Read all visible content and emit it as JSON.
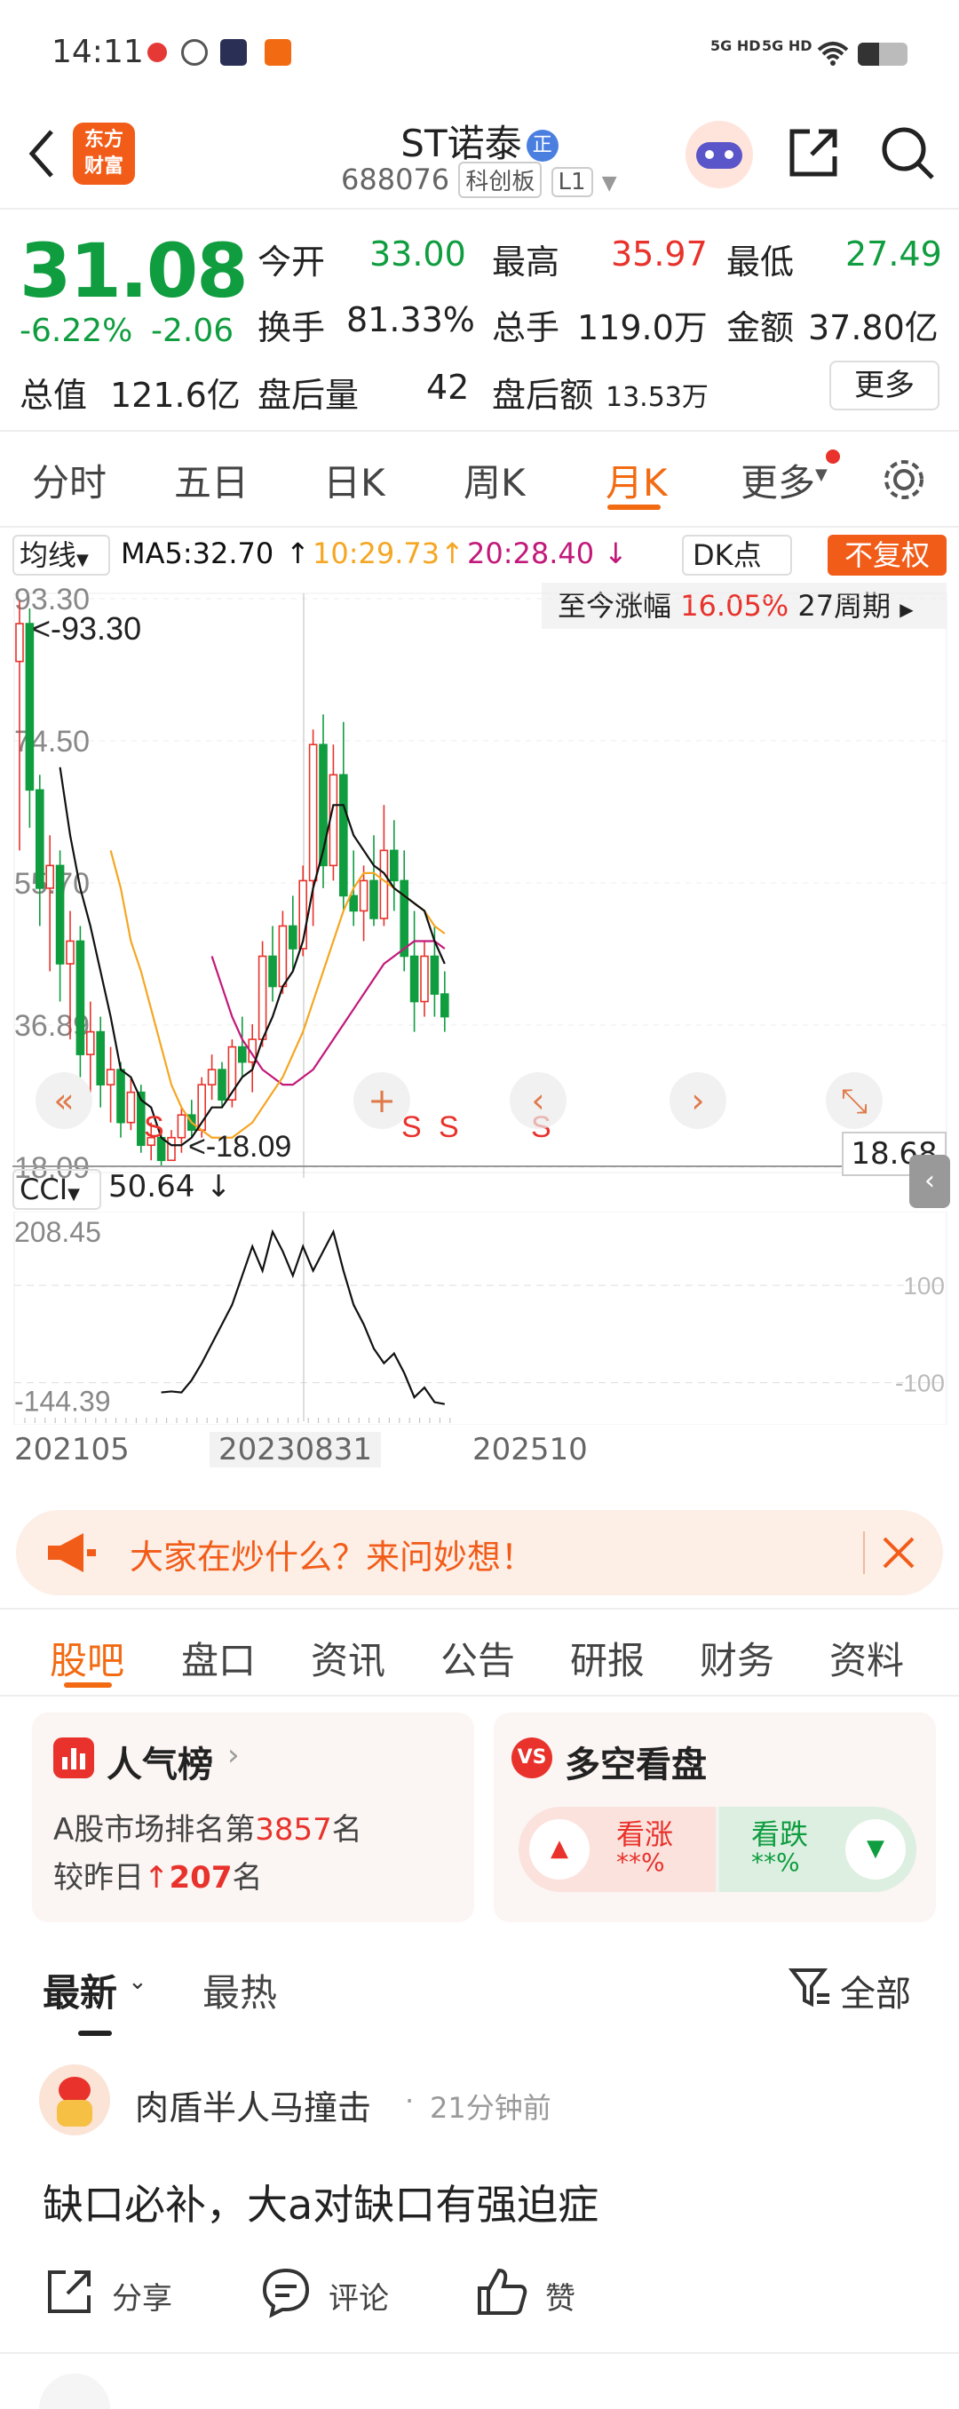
{
  "status_bar": {
    "time": "14:11",
    "signal1": "5G HD",
    "signal2": "5G HD"
  },
  "header": {
    "logo_line1": "东方",
    "logo_line2": "财富",
    "stock_name": "ST诺泰",
    "reg_badge": "正",
    "stock_code": "688076",
    "board": "科创板",
    "level": "L1"
  },
  "quote": {
    "price": "31.08",
    "change_pct": "-6.22%",
    "change_amt": "-2.06",
    "open_label": "今开",
    "open": "33.00",
    "high_label": "最高",
    "high": "35.97",
    "low_label": "最低",
    "low": "27.49",
    "turnover_label": "换手",
    "turnover": "81.33%",
    "volume_label": "总手",
    "volume": "119.0万",
    "amount_label": "金额",
    "amount": "37.80亿",
    "mktcap_label": "总值",
    "mktcap": "121.6亿",
    "after_vol_label": "盘后量",
    "after_vol": "42",
    "after_amt_label": "盘后额",
    "after_amt": "13.53万",
    "more_button": "更多"
  },
  "period_tabs": [
    "分时",
    "五日",
    "日K",
    "周K",
    "月K",
    "更多"
  ],
  "active_period": "月K",
  "ma_bar": {
    "indicator": "均线",
    "ma5": "MA5:32.70",
    "ma10": "10:29.73",
    "ma20": "20:28.40",
    "dk": "DK点",
    "adjust": "不复权"
  },
  "range_box": {
    "label": "至今涨幅",
    "value": "16.05%",
    "periods": "27周期"
  },
  "chart_data": {
    "type": "candlestick",
    "y_ticks": [
      "93.30",
      "74.50",
      "55.70",
      "36.89",
      "18.09"
    ],
    "max_label": "<-93.30",
    "min_label": "<-18.09",
    "current_price_tag": "18.68",
    "signals": [
      "S",
      "S",
      "S",
      "S"
    ],
    "ylim": [
      18.09,
      93.3
    ],
    "candles": [
      [
        85,
        93,
        60,
        90
      ],
      [
        90,
        92,
        63,
        68
      ],
      [
        68,
        70,
        50,
        55
      ],
      [
        55,
        62,
        44,
        58
      ],
      [
        58,
        60,
        40,
        45
      ],
      [
        45,
        52,
        35,
        48
      ],
      [
        48,
        50,
        30,
        33
      ],
      [
        33,
        40,
        28,
        36
      ],
      [
        36,
        38,
        26,
        29
      ],
      [
        29,
        34,
        24,
        31
      ],
      [
        31,
        32,
        22,
        24
      ],
      [
        24,
        30,
        23,
        28
      ],
      [
        28,
        29,
        20,
        21
      ],
      [
        21,
        24,
        19,
        22
      ],
      [
        22,
        23,
        18.09,
        19
      ],
      [
        19,
        23,
        19,
        22
      ],
      [
        22,
        26,
        20,
        25
      ],
      [
        25,
        27,
        22,
        23
      ],
      [
        23,
        30,
        22,
        29
      ],
      [
        29,
        33,
        27,
        31
      ],
      [
        31,
        32,
        26,
        27
      ],
      [
        27,
        35,
        26,
        34
      ],
      [
        34,
        38,
        30,
        32
      ],
      [
        32,
        37,
        28,
        35
      ],
      [
        35,
        48,
        34,
        46
      ],
      [
        46,
        50,
        40,
        42
      ],
      [
        42,
        52,
        41,
        50
      ],
      [
        50,
        54,
        44,
        47
      ],
      [
        47,
        58,
        46,
        56
      ],
      [
        56,
        76,
        50,
        74
      ],
      [
        74,
        78,
        55,
        58
      ],
      [
        58,
        74,
        56,
        70
      ],
      [
        70,
        77,
        52,
        54
      ],
      [
        54,
        60,
        50,
        52
      ],
      [
        52,
        58,
        48,
        56
      ],
      [
        56,
        62,
        50,
        51
      ],
      [
        51,
        66,
        50,
        60
      ],
      [
        60,
        64,
        52,
        56
      ],
      [
        56,
        60,
        44,
        46
      ],
      [
        46,
        52,
        36,
        40
      ],
      [
        40,
        48,
        38,
        46
      ],
      [
        46,
        50,
        38,
        41
      ],
      [
        41,
        44,
        36,
        38
      ]
    ],
    "ma5": [
      null,
      null,
      null,
      null,
      71,
      62,
      55,
      50,
      44,
      38,
      31,
      30,
      27,
      26,
      22,
      21,
      21,
      22,
      24,
      26,
      26,
      28,
      30,
      31,
      35,
      38,
      42,
      44,
      48,
      55,
      60,
      66,
      66,
      62,
      60,
      58,
      57,
      55,
      54,
      53,
      52,
      48,
      45
    ],
    "ma10": [
      null,
      null,
      null,
      null,
      null,
      null,
      null,
      null,
      null,
      60,
      55,
      48,
      44,
      39,
      34,
      29,
      26,
      24,
      23,
      22,
      22,
      22,
      23,
      24,
      26,
      28,
      30,
      33,
      36,
      40,
      44,
      48,
      52,
      55,
      57,
      57,
      56,
      55,
      54,
      53,
      52,
      50,
      49
    ],
    "ma20": [
      null,
      null,
      null,
      null,
      null,
      null,
      null,
      null,
      null,
      null,
      null,
      null,
      null,
      null,
      null,
      null,
      null,
      null,
      null,
      46,
      42,
      38,
      35,
      33,
      31,
      30,
      29,
      29,
      30,
      31,
      33,
      35,
      37,
      39,
      41,
      43,
      45,
      46,
      47,
      48,
      48,
      48,
      47
    ],
    "cci": {
      "label": "CCI",
      "value": "50.64",
      "y_top": "208.45",
      "y_bottom": "-144.39",
      "ref_hi": "100",
      "ref_lo": "-100",
      "values": [
        null,
        null,
        null,
        null,
        null,
        null,
        null,
        null,
        null,
        null,
        null,
        null,
        null,
        null,
        -120,
        -118,
        -120,
        -95,
        -60,
        -20,
        20,
        60,
        120,
        180,
        130,
        210,
        170,
        120,
        180,
        130,
        170,
        210,
        130,
        60,
        20,
        -30,
        -60,
        -40,
        -80,
        -130,
        -110,
        -140,
        -144
      ]
    },
    "x_labels": [
      "202105",
      "20230831",
      "202510"
    ]
  },
  "banner": {
    "text": "大家在炒什么？来问妙想！"
  },
  "section_tabs": [
    "股吧",
    "盘口",
    "资讯",
    "公告",
    "研报",
    "财务",
    "资料"
  ],
  "active_section": "股吧",
  "popularity": {
    "title": "人气榜",
    "line1_prefix": "A股市场排名第",
    "rank": "3857",
    "line1_suffix": "名",
    "line2_prefix": "较昨日",
    "change": "207",
    "line2_suffix": "名"
  },
  "bullbear": {
    "title": "多空看盘",
    "bull_label": "看涨",
    "bull_value": "**%",
    "bear_label": "看跌",
    "bear_value": "**%"
  },
  "feed_tabs": {
    "latest": "最新",
    "hot": "最热",
    "filter": "全部"
  },
  "post": {
    "author": "肉盾半人马撞击",
    "time": "21分钟前",
    "content": "缺口必补，大a对缺口有强迫症",
    "share": "分享",
    "comment": "评论",
    "like": "赞"
  },
  "colors": {
    "up": "#e8322b",
    "down": "#0f9d3f",
    "ma5": "#111111",
    "ma10": "#f5a623",
    "ma20": "#c2187a",
    "accent": "#f26a12"
  }
}
